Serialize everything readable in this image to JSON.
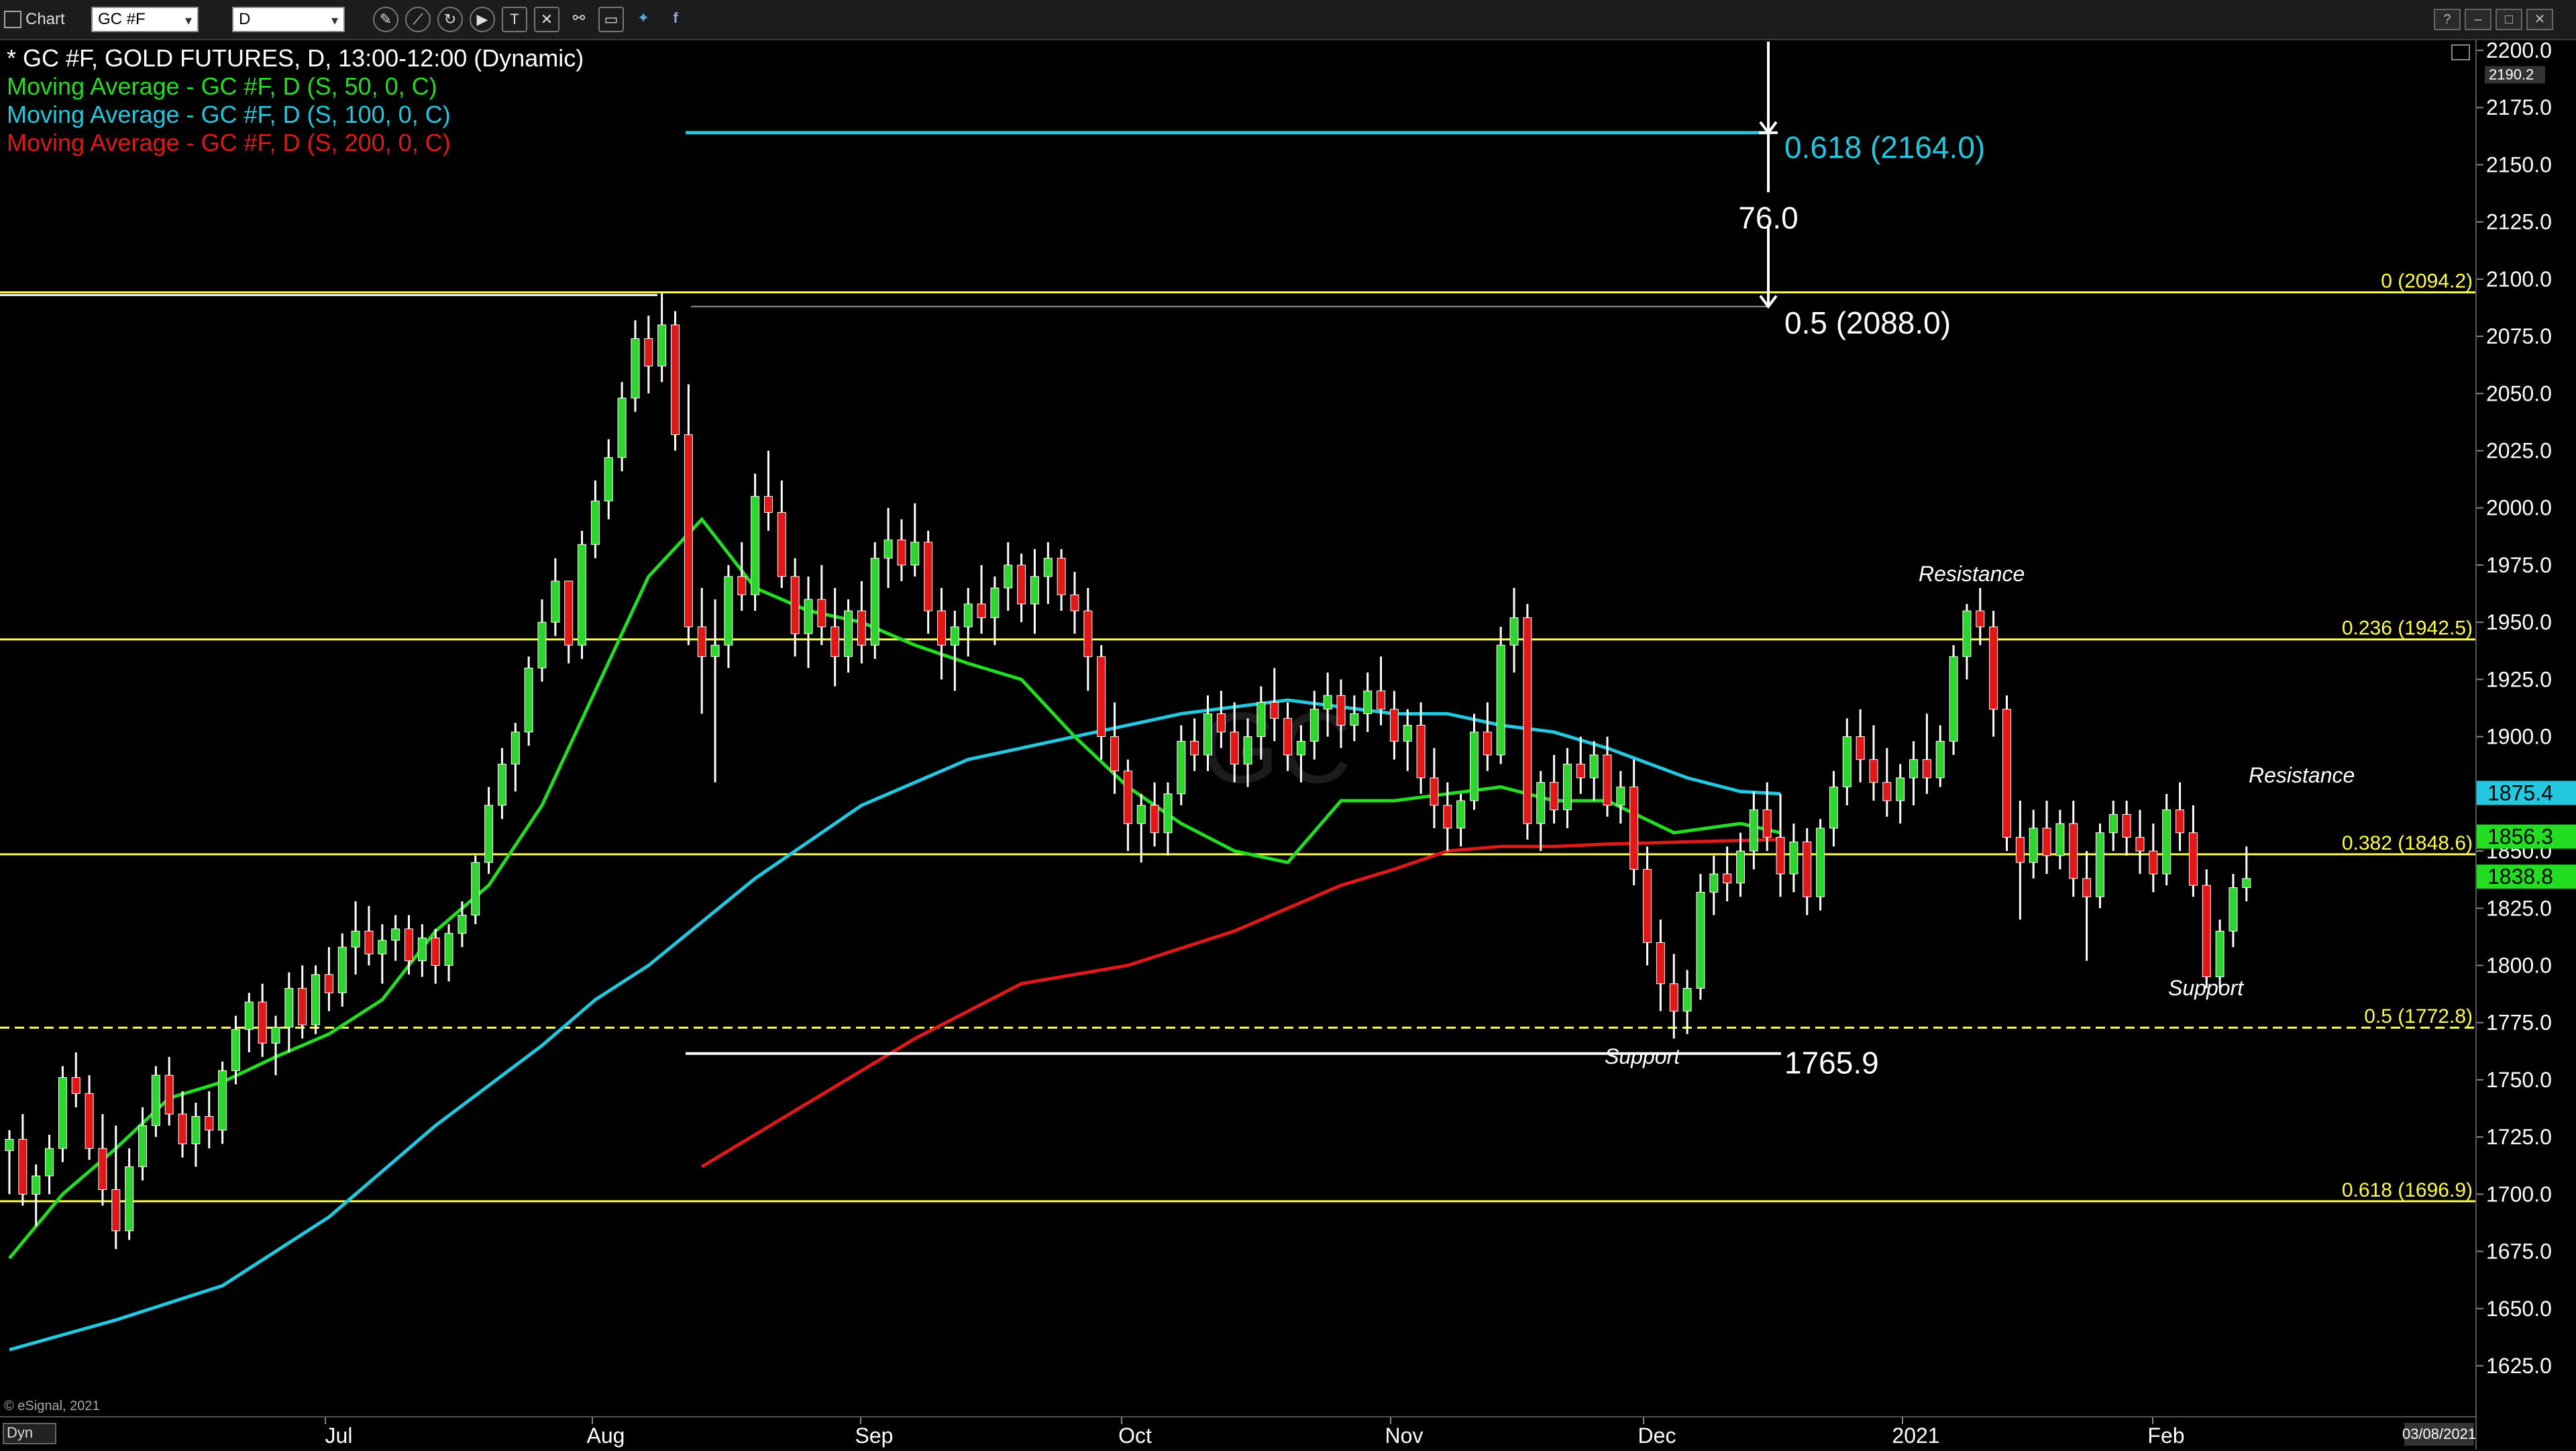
{
  "toolbar": {
    "app_label": "Chart",
    "symbol_value": "GC #F",
    "interval_value": "D",
    "icons": [
      "draw-pencil-icon",
      "line-tool-icon",
      "loop-icon",
      "play-icon",
      "text-tool-icon",
      "x-tool-icon",
      "link-icon",
      "message-icon",
      "twitter-icon",
      "facebook-icon"
    ]
  },
  "window_buttons": [
    "?",
    "–",
    "□",
    "✕"
  ],
  "legend": {
    "title": "* GC #F, GOLD FUTURES, D, 13:00-12:00 (Dynamic)",
    "ma50": "Moving Average - GC #F, D (S, 50, 0, C)",
    "ma100": "Moving Average - GC #F, D (S, 100, 0, C)",
    "ma200": "Moving Average - GC #F, D (S, 200, 0, C)"
  },
  "colors": {
    "up": "#2ed52e",
    "down": "#e01818",
    "ma50": "#22dd22",
    "ma100": "#22c8e0",
    "ma200": "#e01818",
    "fib": "#ffff44",
    "white": "#ffffff"
  },
  "annotations": {
    "fib_0618_ext": "0.618 (2164.0)",
    "measure": "76.0",
    "fib_05_ext": "0.5 (2088.0)",
    "fib_0": "0 (2094.2)",
    "fib_0236": "0.236 (1942.5)",
    "fib_0382": "0.382 (1848.6)",
    "fib_05": "0.5 (1772.8)",
    "fib_0618": "0.618 (1696.9)",
    "low_1765": "1765.9",
    "resistance_top": "Resistance",
    "resistance_right": "Resistance",
    "support_nov": "Support",
    "support_feb": "Support",
    "watermark": "© eSignal, 2021",
    "dyn": "Dyn"
  },
  "price_axis": {
    "ticks": [
      "2200.0",
      "2175.0",
      "2150.0",
      "2125.0",
      "2100.0",
      "2075.0",
      "2050.0",
      "2025.0",
      "2000.0",
      "1975.0",
      "1950.0",
      "1925.0",
      "1900.0",
      "1875.0",
      "1850.0",
      "1825.0",
      "1800.0",
      "1775.0",
      "1750.0",
      "1725.0",
      "1700.0",
      "1675.0",
      "1650.0",
      "1625.0"
    ],
    "top_tag": "2190.2",
    "tag_ma100": "1875.4",
    "tag_ma50": "1856.3",
    "tag_last": "1838.8"
  },
  "time_axis": {
    "labels": [
      "Jul",
      "Aug",
      "Sep",
      "Oct",
      "Nov",
      "Dec",
      "2021",
      "Feb"
    ],
    "corner_date": "03/08/2021"
  },
  "chart_data": {
    "type": "candlestick",
    "symbol": "GC #F",
    "ylim": [
      1605,
      2210
    ],
    "candles": [
      [
        1719,
        1728,
        1700,
        1724
      ],
      [
        1724,
        1735,
        1695,
        1700
      ],
      [
        1700,
        1713,
        1686,
        1708
      ],
      [
        1708,
        1726,
        1700,
        1720
      ],
      [
        1720,
        1756,
        1714,
        1751
      ],
      [
        1751,
        1762,
        1738,
        1744
      ],
      [
        1744,
        1752,
        1715,
        1720
      ],
      [
        1720,
        1735,
        1695,
        1702
      ],
      [
        1702,
        1730,
        1676,
        1684
      ],
      [
        1684,
        1720,
        1680,
        1712
      ],
      [
        1712,
        1738,
        1706,
        1730
      ],
      [
        1730,
        1756,
        1725,
        1752
      ],
      [
        1752,
        1760,
        1730,
        1735
      ],
      [
        1735,
        1745,
        1716,
        1722
      ],
      [
        1722,
        1740,
        1712,
        1734
      ],
      [
        1734,
        1745,
        1720,
        1728
      ],
      [
        1728,
        1758,
        1722,
        1754
      ],
      [
        1754,
        1778,
        1748,
        1772
      ],
      [
        1772,
        1788,
        1762,
        1784
      ],
      [
        1784,
        1792,
        1760,
        1766
      ],
      [
        1766,
        1778,
        1752,
        1773
      ],
      [
        1773,
        1797,
        1762,
        1790
      ],
      [
        1790,
        1800,
        1768,
        1774
      ],
      [
        1774,
        1800,
        1770,
        1796
      ],
      [
        1796,
        1808,
        1780,
        1788
      ],
      [
        1788,
        1814,
        1782,
        1808
      ],
      [
        1808,
        1828,
        1796,
        1815
      ],
      [
        1815,
        1826,
        1800,
        1805
      ],
      [
        1805,
        1818,
        1792,
        1811
      ],
      [
        1811,
        1822,
        1802,
        1816
      ],
      [
        1816,
        1822,
        1796,
        1802
      ],
      [
        1802,
        1818,
        1795,
        1812
      ],
      [
        1812,
        1816,
        1792,
        1800
      ],
      [
        1800,
        1818,
        1793,
        1814
      ],
      [
        1814,
        1828,
        1808,
        1822
      ],
      [
        1822,
        1848,
        1818,
        1845
      ],
      [
        1845,
        1878,
        1840,
        1870
      ],
      [
        1870,
        1895,
        1864,
        1888
      ],
      [
        1888,
        1906,
        1876,
        1902
      ],
      [
        1902,
        1935,
        1896,
        1930
      ],
      [
        1930,
        1960,
        1924,
        1950
      ],
      [
        1950,
        1978,
        1944,
        1968
      ],
      [
        1968,
        1962,
        1932,
        1940
      ],
      [
        1940,
        1990,
        1934,
        1984
      ],
      [
        1984,
        2012,
        1978,
        2003
      ],
      [
        2003,
        2030,
        1995,
        2022
      ],
      [
        2022,
        2055,
        2016,
        2048
      ],
      [
        2048,
        2082,
        2042,
        2074
      ],
      [
        2074,
        2084,
        2050,
        2062
      ],
      [
        2062,
        2094,
        2055,
        2080
      ],
      [
        2080,
        2086,
        2025,
        2032
      ],
      [
        2032,
        2054,
        1940,
        1948
      ],
      [
        1948,
        1965,
        1910,
        1935
      ],
      [
        1935,
        1960,
        1880,
        1940
      ],
      [
        1940,
        1975,
        1930,
        1970
      ],
      [
        1970,
        1985,
        1955,
        1962
      ],
      [
        1962,
        2015,
        1955,
        2005
      ],
      [
        2005,
        2025,
        1990,
        1998
      ],
      [
        1998,
        2012,
        1965,
        1970
      ],
      [
        1970,
        1978,
        1935,
        1945
      ],
      [
        1945,
        1970,
        1930,
        1960
      ],
      [
        1960,
        1975,
        1940,
        1948
      ],
      [
        1948,
        1965,
        1922,
        1935
      ],
      [
        1935,
        1960,
        1928,
        1955
      ],
      [
        1955,
        1968,
        1932,
        1940
      ],
      [
        1940,
        1985,
        1934,
        1978
      ],
      [
        1978,
        2000,
        1965,
        1986
      ],
      [
        1986,
        1995,
        1968,
        1975
      ],
      [
        1975,
        2002,
        1970,
        1985
      ],
      [
        1985,
        1990,
        1945,
        1955
      ],
      [
        1955,
        1965,
        1925,
        1940
      ],
      [
        1940,
        1955,
        1920,
        1948
      ],
      [
        1948,
        1965,
        1935,
        1958
      ],
      [
        1958,
        1975,
        1945,
        1952
      ],
      [
        1952,
        1970,
        1940,
        1965
      ],
      [
        1965,
        1985,
        1955,
        1975
      ],
      [
        1975,
        1980,
        1950,
        1958
      ],
      [
        1958,
        1982,
        1945,
        1970
      ],
      [
        1970,
        1985,
        1958,
        1978
      ],
      [
        1978,
        1982,
        1955,
        1962
      ],
      [
        1962,
        1972,
        1945,
        1955
      ],
      [
        1955,
        1965,
        1920,
        1935
      ],
      [
        1935,
        1940,
        1890,
        1900
      ],
      [
        1900,
        1915,
        1875,
        1885
      ],
      [
        1885,
        1890,
        1850,
        1862
      ],
      [
        1862,
        1875,
        1845,
        1870
      ],
      [
        1870,
        1880,
        1852,
        1858
      ],
      [
        1858,
        1880,
        1848,
        1875
      ],
      [
        1875,
        1905,
        1870,
        1898
      ],
      [
        1898,
        1908,
        1885,
        1892
      ],
      [
        1892,
        1918,
        1885,
        1910
      ],
      [
        1910,
        1920,
        1895,
        1902
      ],
      [
        1902,
        1915,
        1880,
        1888
      ],
      [
        1888,
        1908,
        1878,
        1900
      ],
      [
        1900,
        1922,
        1890,
        1915
      ],
      [
        1915,
        1930,
        1898,
        1908
      ],
      [
        1908,
        1915,
        1885,
        1892
      ],
      [
        1892,
        1905,
        1880,
        1898
      ],
      [
        1898,
        1920,
        1890,
        1912
      ],
      [
        1912,
        1928,
        1900,
        1918
      ],
      [
        1918,
        1925,
        1895,
        1905
      ],
      [
        1905,
        1918,
        1898,
        1910
      ],
      [
        1910,
        1928,
        1902,
        1920
      ],
      [
        1920,
        1935,
        1905,
        1912
      ],
      [
        1912,
        1920,
        1890,
        1898
      ],
      [
        1898,
        1912,
        1885,
        1905
      ],
      [
        1905,
        1915,
        1875,
        1882
      ],
      [
        1882,
        1895,
        1860,
        1870
      ],
      [
        1870,
        1880,
        1850,
        1860
      ],
      [
        1860,
        1875,
        1852,
        1872
      ],
      [
        1872,
        1910,
        1868,
        1902
      ],
      [
        1902,
        1915,
        1885,
        1892
      ],
      [
        1892,
        1948,
        1888,
        1940
      ],
      [
        1940,
        1965,
        1928,
        1952
      ],
      [
        1952,
        1958,
        1855,
        1862
      ],
      [
        1862,
        1885,
        1850,
        1880
      ],
      [
        1880,
        1892,
        1862,
        1868
      ],
      [
        1868,
        1895,
        1860,
        1888
      ],
      [
        1888,
        1900,
        1875,
        1882
      ],
      [
        1882,
        1898,
        1872,
        1892
      ],
      [
        1892,
        1900,
        1865,
        1870
      ],
      [
        1870,
        1885,
        1862,
        1878
      ],
      [
        1878,
        1890,
        1835,
        1842
      ],
      [
        1842,
        1852,
        1800,
        1810
      ],
      [
        1810,
        1820,
        1780,
        1792
      ],
      [
        1792,
        1805,
        1768,
        1780
      ],
      [
        1780,
        1798,
        1770,
        1790
      ],
      [
        1790,
        1840,
        1785,
        1832
      ],
      [
        1832,
        1848,
        1822,
        1840
      ],
      [
        1840,
        1852,
        1828,
        1836
      ],
      [
        1836,
        1858,
        1830,
        1850
      ],
      [
        1850,
        1876,
        1842,
        1868
      ],
      [
        1868,
        1880,
        1850,
        1856
      ],
      [
        1856,
        1875,
        1830,
        1840
      ],
      [
        1840,
        1862,
        1832,
        1854
      ],
      [
        1854,
        1860,
        1822,
        1830
      ],
      [
        1830,
        1864,
        1824,
        1860
      ],
      [
        1860,
        1885,
        1852,
        1878
      ],
      [
        1878,
        1908,
        1870,
        1900
      ],
      [
        1900,
        1912,
        1880,
        1890
      ],
      [
        1890,
        1905,
        1872,
        1880
      ],
      [
        1880,
        1895,
        1865,
        1872
      ],
      [
        1872,
        1888,
        1862,
        1882
      ],
      [
        1882,
        1898,
        1870,
        1890
      ],
      [
        1890,
        1910,
        1875,
        1882
      ],
      [
        1882,
        1905,
        1878,
        1898
      ],
      [
        1898,
        1940,
        1892,
        1935
      ],
      [
        1935,
        1958,
        1925,
        1955
      ],
      [
        1955,
        1965,
        1940,
        1948
      ],
      [
        1948,
        1955,
        1900,
        1912
      ],
      [
        1912,
        1918,
        1850,
        1856
      ],
      [
        1856,
        1872,
        1820,
        1845
      ],
      [
        1845,
        1868,
        1838,
        1860
      ],
      [
        1860,
        1872,
        1840,
        1848
      ],
      [
        1848,
        1868,
        1842,
        1862
      ],
      [
        1862,
        1872,
        1830,
        1838
      ],
      [
        1838,
        1850,
        1802,
        1830
      ],
      [
        1830,
        1862,
        1825,
        1858
      ],
      [
        1858,
        1872,
        1850,
        1866
      ],
      [
        1866,
        1872,
        1848,
        1856
      ],
      [
        1856,
        1868,
        1840,
        1850
      ],
      [
        1850,
        1862,
        1832,
        1840
      ],
      [
        1840,
        1875,
        1835,
        1868
      ],
      [
        1868,
        1880,
        1850,
        1858
      ],
      [
        1858,
        1870,
        1830,
        1835
      ],
      [
        1835,
        1842,
        1790,
        1795
      ],
      [
        1795,
        1820,
        1790,
        1815
      ],
      [
        1815,
        1840,
        1808,
        1834
      ],
      [
        1834,
        1852,
        1828,
        1838
      ]
    ],
    "ma50": [
      [
        0,
        1672
      ],
      [
        40,
        1700
      ],
      [
        80,
        1720
      ],
      [
        120,
        1742
      ],
      [
        160,
        1749
      ],
      [
        200,
        1760
      ],
      [
        240,
        1770
      ],
      [
        280,
        1785
      ],
      [
        320,
        1815
      ],
      [
        360,
        1835
      ],
      [
        400,
        1870
      ],
      [
        440,
        1920
      ],
      [
        480,
        1970
      ],
      [
        520,
        1995
      ],
      [
        560,
        1965
      ],
      [
        600,
        1955
      ],
      [
        640,
        1950
      ],
      [
        680,
        1940
      ],
      [
        720,
        1932
      ],
      [
        760,
        1925
      ],
      [
        800,
        1900
      ],
      [
        840,
        1878
      ],
      [
        880,
        1862
      ],
      [
        920,
        1850
      ],
      [
        960,
        1845
      ],
      [
        1000,
        1872
      ],
      [
        1040,
        1872
      ],
      [
        1080,
        1875
      ],
      [
        1120,
        1878
      ],
      [
        1160,
        1872
      ],
      [
        1200,
        1872
      ],
      [
        1250,
        1858
      ],
      [
        1300,
        1862
      ],
      [
        1330,
        1858
      ]
    ],
    "ma100": [
      [
        0,
        1632
      ],
      [
        80,
        1645
      ],
      [
        160,
        1660
      ],
      [
        240,
        1690
      ],
      [
        320,
        1730
      ],
      [
        400,
        1765
      ],
      [
        440,
        1785
      ],
      [
        480,
        1800
      ],
      [
        560,
        1838
      ],
      [
        640,
        1870
      ],
      [
        720,
        1890
      ],
      [
        800,
        1900
      ],
      [
        880,
        1910
      ],
      [
        960,
        1916
      ],
      [
        1000,
        1913
      ],
      [
        1040,
        1910
      ],
      [
        1080,
        1910
      ],
      [
        1120,
        1905
      ],
      [
        1160,
        1902
      ],
      [
        1200,
        1895
      ],
      [
        1260,
        1882
      ],
      [
        1300,
        1876
      ],
      [
        1330,
        1875
      ]
    ],
    "ma200": [
      [
        520,
        1712
      ],
      [
        600,
        1740
      ],
      [
        680,
        1768
      ],
      [
        760,
        1792
      ],
      [
        840,
        1800
      ],
      [
        920,
        1815
      ],
      [
        1000,
        1835
      ],
      [
        1040,
        1842
      ],
      [
        1080,
        1850
      ],
      [
        1120,
        1852
      ],
      [
        1160,
        1852
      ],
      [
        1200,
        1853
      ],
      [
        1260,
        1854
      ],
      [
        1330,
        1855
      ]
    ],
    "fib_levels": [
      {
        "ratio": "0",
        "price": 2094.2
      },
      {
        "ratio": "0.236",
        "price": 1942.5
      },
      {
        "ratio": "0.382",
        "price": 1848.6
      },
      {
        "ratio": "0.5",
        "price": 1772.8
      },
      {
        "ratio": "0.618",
        "price": 1696.9
      }
    ],
    "extension_0618": 2164.0,
    "extension_05": 2088.0,
    "measure_delta": 76.0,
    "low_level": 1765.9,
    "last_price": 1838.8,
    "ma100_last": 1875.4,
    "ma50_last": 1856.3,
    "axis_high": 2190.2
  }
}
